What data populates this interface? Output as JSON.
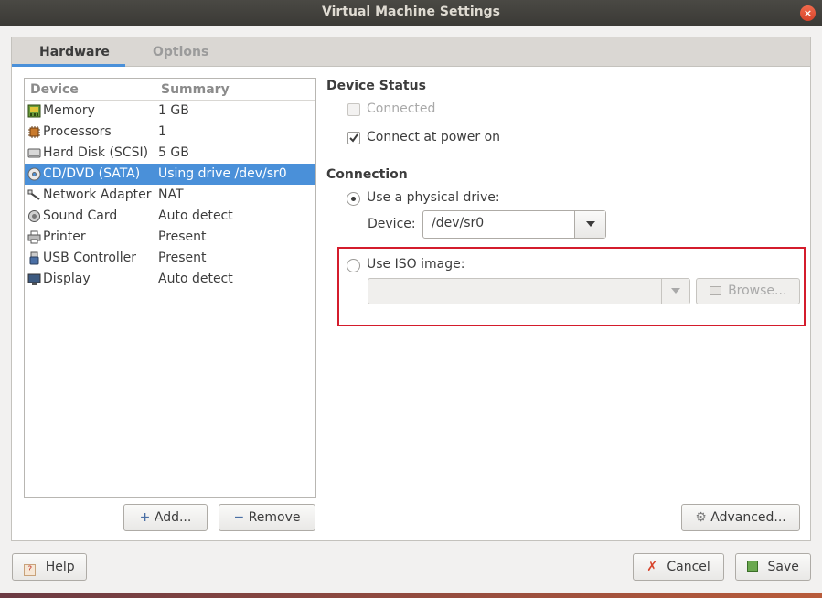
{
  "window": {
    "title": "Virtual Machine Settings",
    "close_glyph": "×"
  },
  "tabs": [
    {
      "label": "Hardware"
    },
    {
      "label": "Options"
    }
  ],
  "device_list": {
    "headers": {
      "device": "Device",
      "summary": "Summary"
    },
    "items": [
      {
        "name": "Memory",
        "summary": "1 GB",
        "icon": "memory-icon"
      },
      {
        "name": "Processors",
        "summary": "1",
        "icon": "processor-icon"
      },
      {
        "name": "Hard Disk (SCSI)",
        "summary": "5 GB",
        "icon": "hard-disk-icon"
      },
      {
        "name": "CD/DVD (SATA)",
        "summary": "Using drive /dev/sr0",
        "icon": "cd-dvd-icon",
        "selected": true
      },
      {
        "name": "Network Adapter",
        "summary": "NAT",
        "icon": "network-adapter-icon"
      },
      {
        "name": "Sound Card",
        "summary": "Auto detect",
        "icon": "sound-card-icon"
      },
      {
        "name": "Printer",
        "summary": "Present",
        "icon": "printer-icon"
      },
      {
        "name": "USB Controller",
        "summary": "Present",
        "icon": "usb-icon"
      },
      {
        "name": "Display",
        "summary": "Auto detect",
        "icon": "display-icon"
      }
    ]
  },
  "list_buttons": {
    "add": "Add...",
    "remove": "Remove"
  },
  "device_status": {
    "heading": "Device Status",
    "connected": {
      "label": "Connected",
      "checked": false,
      "enabled": false
    },
    "connect_at_power_on": {
      "label": "Connect at power on",
      "checked": true
    }
  },
  "connection": {
    "heading": "Connection",
    "physical": {
      "label": "Use a physical drive:",
      "selected": true
    },
    "device_label": "Device:",
    "device_value": "/dev/sr0",
    "iso": {
      "label": "Use ISO image:",
      "selected": false,
      "value": ""
    },
    "browse": "Browse..."
  },
  "advanced": "Advanced...",
  "footer": {
    "help": "Help",
    "cancel": "Cancel",
    "save": "Save"
  },
  "colors": {
    "accent": "#4a90d9",
    "highlight": "#d41c2c"
  }
}
